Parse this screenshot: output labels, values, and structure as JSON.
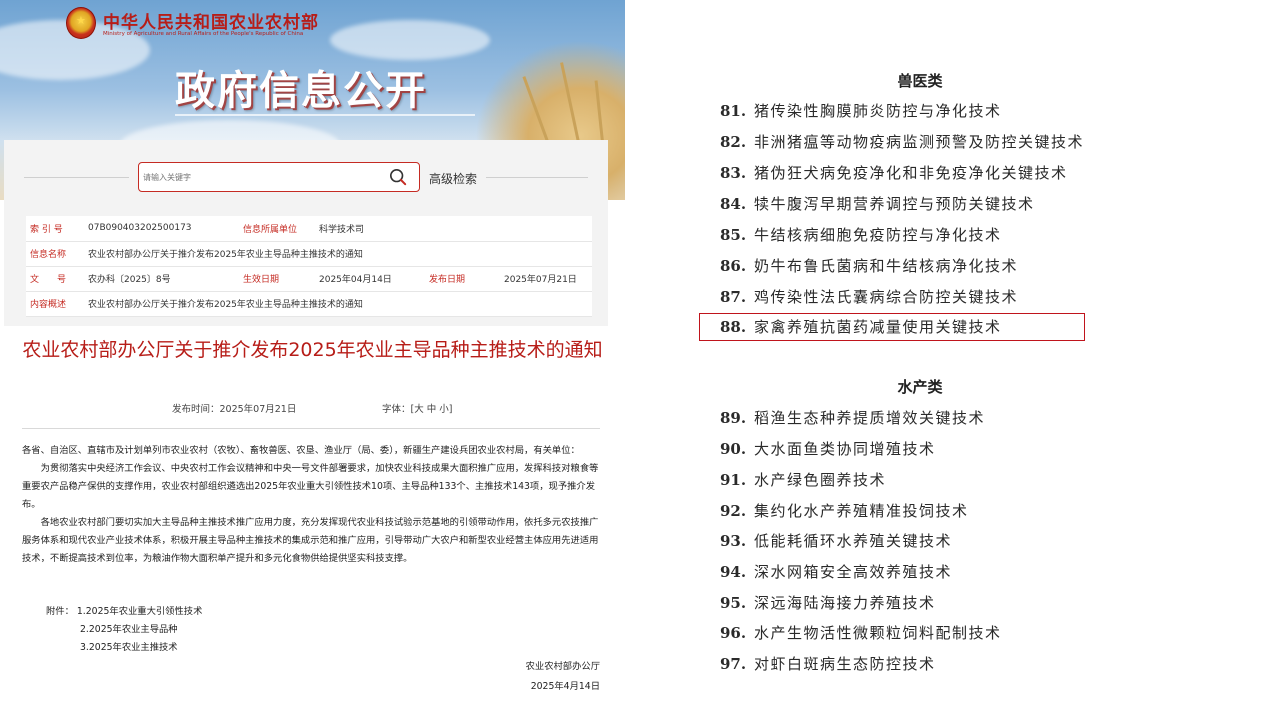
{
  "header": {
    "ministry_cn": "中华人民共和国农业农村部",
    "ministry_en": "Ministry of Agriculture and Rural Affairs of the People's Republic of China",
    "section_title": "政府信息公开"
  },
  "search": {
    "placeholder": "请输入关键字",
    "advanced_label": "高级检索"
  },
  "info": {
    "index_label": "索 引 号",
    "index_value": "07B090403202500173",
    "dept_label": "信息所属单位",
    "dept_value": "科学技术司",
    "name_label": "信息名称",
    "name_value": "农业农村部办公厅关于推介发布2025年农业主导品种主推技术的通知",
    "docno_label": "文　　号",
    "docno_value": "农办科〔2025〕8号",
    "effective_label": "生效日期",
    "effective_value": "2025年04月14日",
    "publish_label": "发布日期",
    "publish_value": "2025年07月21日",
    "summary_label": "内容概述",
    "summary_value": "农业农村部办公厅关于推介发布2025年农业主导品种主推技术的通知"
  },
  "document": {
    "title": "农业农村部办公厅关于推介发布2025年农业主导品种主推技术的通知",
    "pub_date": "发布时间：2025年07月21日",
    "font_size": "字体：[大 中 小]",
    "salutation": "各省、自治区、直辖市及计划单列市农业农村（农牧）、畜牧兽医、农垦、渔业厅（局、委），新疆生产建设兵团农业农村局，有关单位：",
    "para1": "为贯彻落实中央经济工作会议、中央农村工作会议精神和中央一号文件部署要求，加快农业科技成果大面积推广应用，发挥科技对粮食等重要农产品稳产保供的支撑作用，农业农村部组织遴选出2025年农业重大引领性技术10项、主导品种133个、主推技术143项，现予推介发布。",
    "para2": "各地农业农村部门要切实加大主导品种主推技术推广应用力度，充分发挥现代农业科技试验示范基地的引领带动作用，依托多元农技推广服务体系和现代农业产业技术体系，积极开展主导品种主推技术的集成示范和推广应用，引导带动广大农户和新型农业经营主体应用先进适用技术，不断提高技术到位率，为粮油作物大面积单产提升和多元化食物供给提供坚实科技支撑。",
    "attach_label": "附件：",
    "attach_1": "1.2025年农业重大引领性技术",
    "attach_2": "2.2025年农业主导品种",
    "attach_3": "3.2025年农业主推技术",
    "sign_org": "农业农村部办公厅",
    "sign_date": "2025年4月14日"
  },
  "right_list": {
    "vet_title": "兽医类",
    "vet_items": [
      {
        "num": "81.",
        "text": "猪传染性胸膜肺炎防控与净化技术"
      },
      {
        "num": "82.",
        "text": "非洲猪瘟等动物疫病监测预警及防控关键技术"
      },
      {
        "num": "83.",
        "text": "猪伪狂犬病免疫净化和非免疫净化关键技术"
      },
      {
        "num": "84.",
        "text": "犊牛腹泻早期营养调控与预防关键技术"
      },
      {
        "num": "85.",
        "text": "牛结核病细胞免疫防控与净化技术"
      },
      {
        "num": "86.",
        "text": "奶牛布鲁氏菌病和牛结核病净化技术"
      },
      {
        "num": "87.",
        "text": "鸡传染性法氏囊病综合防控关键技术"
      },
      {
        "num": "88.",
        "text": "家禽养殖抗菌药减量使用关键技术"
      }
    ],
    "aqua_title": "水产类",
    "aqua_items": [
      {
        "num": "89.",
        "text": "稻渔生态种养提质增效关键技术"
      },
      {
        "num": "90.",
        "text": "大水面鱼类协同增殖技术"
      },
      {
        "num": "91.",
        "text": "水产绿色圈养技术"
      },
      {
        "num": "92.",
        "text": "集约化水产养殖精准投饲技术"
      },
      {
        "num": "93.",
        "text": "低能耗循环水养殖关键技术"
      },
      {
        "num": "94.",
        "text": "深水网箱安全高效养殖技术"
      },
      {
        "num": "95.",
        "text": "深远海陆海接力养殖技术"
      },
      {
        "num": "96.",
        "text": "水产生物活性微颗粒饲料配制技术"
      },
      {
        "num": "97.",
        "text": "对虾白斑病生态防控技术"
      }
    ],
    "highlight_color": "#c0141c"
  },
  "colors": {
    "accent_red": "#b71d18",
    "label_red": "#c52b23"
  }
}
